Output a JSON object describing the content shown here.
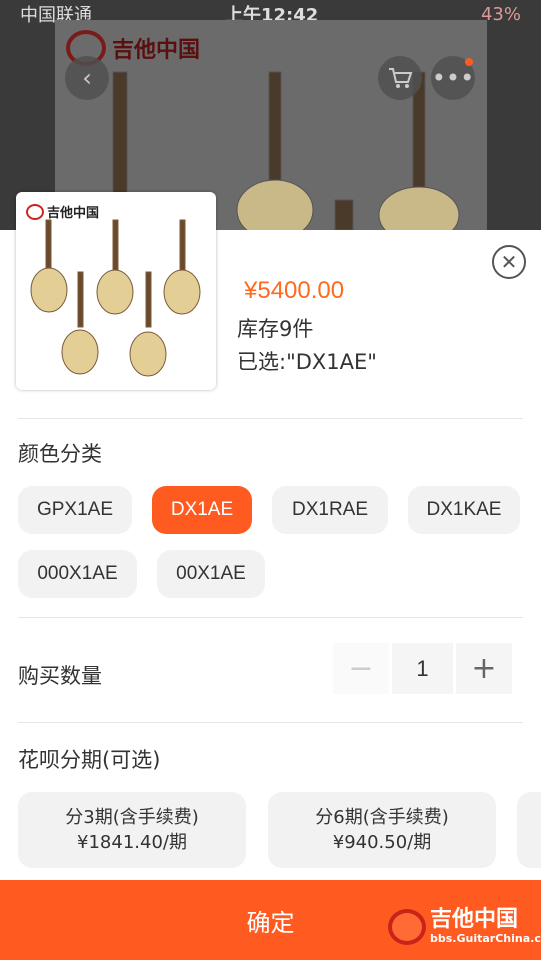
{
  "status_bar": {
    "carrier": "中国联通",
    "time": "上午12:42",
    "battery": "43%"
  },
  "background": {
    "logo_text": "吉他中国",
    "logo_url": "www.GUITARCHINA.com"
  },
  "sheet": {
    "price": "¥5400.00",
    "stock": "库存9件",
    "selected": "已选:\"DX1AE\"",
    "thumb_logo": "吉他中国"
  },
  "color_section": {
    "title": "颜色分类",
    "options": [
      "GPX1AE",
      "DX1AE",
      "DX1RAE",
      "DX1KAE",
      "000X1AE",
      "00X1AE"
    ],
    "selected": "DX1AE"
  },
  "quantity_section": {
    "title": "购买数量",
    "minus": "−",
    "value": "1",
    "plus": "+"
  },
  "installment_section": {
    "title": "花呗分期(可选)",
    "plans": [
      {
        "label": "分3期(含手续费)",
        "amount": "¥1841.40/期"
      },
      {
        "label": "分6期(含手续费)",
        "amount": "¥940.50/期"
      }
    ]
  },
  "confirm_label": "确定",
  "watermark": {
    "title": "吉他中国",
    "url": "bbs.GuitarChina.com"
  },
  "colors": {
    "accent": "#ff5a1f"
  },
  "icons": [
    "chevron-left-icon",
    "cart-icon",
    "more-icon",
    "close-icon"
  ]
}
